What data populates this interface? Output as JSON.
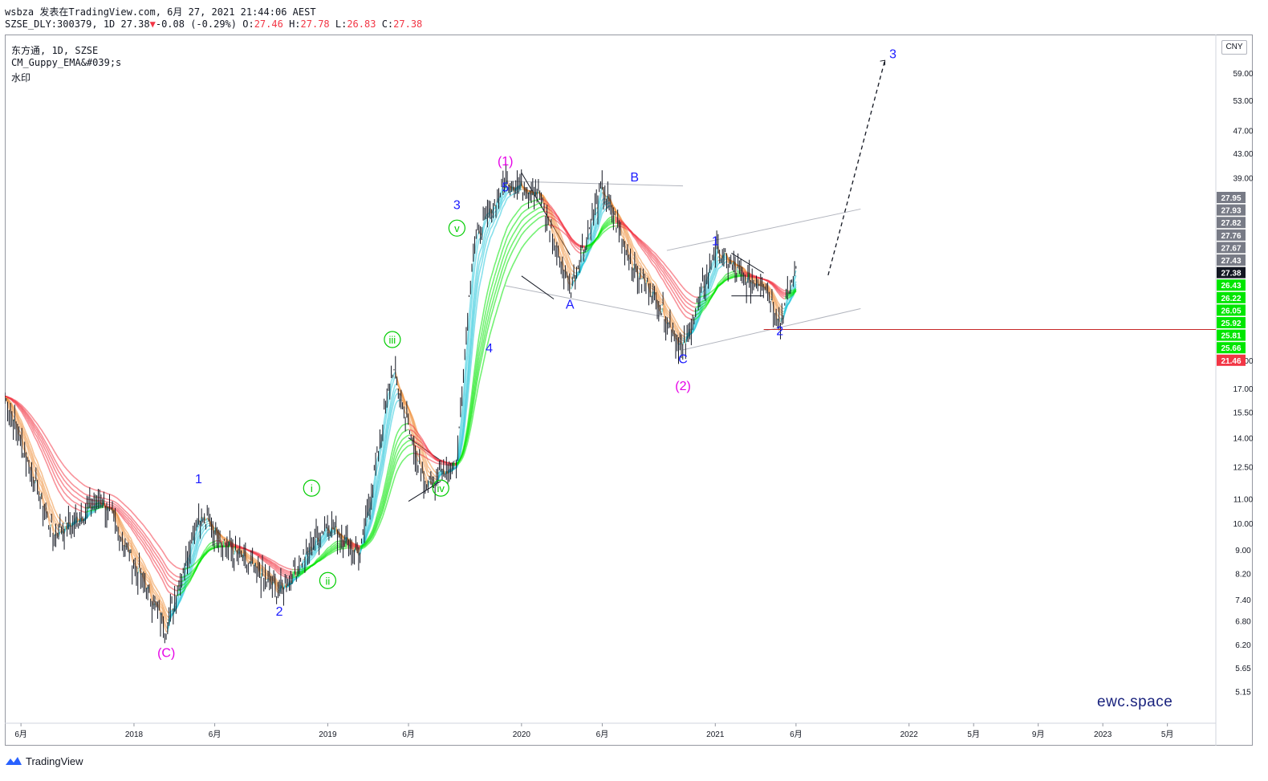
{
  "header": {
    "publisher": "wsbza 发表在TradingView.com, 6月 27, 2021 21:44:06 AEST",
    "symbol": "SZSE_DLY:300379, 1D 27.38",
    "change_arrow": "▼",
    "change": "-0.08 (-0.29%)",
    "o_label": "O:",
    "o_value": "27.46",
    "h_label": "H:",
    "h_value": "27.78",
    "l_label": "L:",
    "l_value": "26.83",
    "c_label": "C:",
    "c_value": "27.38"
  },
  "legend": {
    "line1": "东方通, 1D, SZSE",
    "line2": "CM_Guppy_EMA&#039;s",
    "line3": "水印"
  },
  "currency": "CNY",
  "watermark": "ewc.space",
  "footer": {
    "brand": "TradingView"
  },
  "colors": {
    "price_bars": "#131722",
    "ema_bull": "#00e600",
    "ema_bear": "#f23645",
    "ema_neutral": "#808080",
    "wave_blue": "#1a1aff",
    "wave_magenta": "#e600e6",
    "wave_green": "#00cc00",
    "support_line": "#c62828",
    "current_price": "#131722"
  },
  "chart_data": {
    "type": "line",
    "title": "",
    "xlabel": "",
    "ylabel": "",
    "y_scale": "log",
    "x_tick_labels": [
      "6月",
      "2018",
      "6月",
      "2019",
      "6月",
      "2020",
      "6月",
      "2021",
      "6月",
      "2022",
      "5月",
      "9月",
      "2023",
      "5月"
    ],
    "y_tick_labels": [
      "5.15",
      "5.65",
      "6.20",
      "6.80",
      "7.40",
      "8.20",
      "9.00",
      "10.00",
      "11.00",
      "12.50",
      "14.00",
      "15.50",
      "17.00",
      "19.00",
      "39.00",
      "43.00",
      "47.00",
      "53.00",
      "59.00"
    ],
    "y_ticks": [
      5.15,
      5.65,
      6.2,
      6.8,
      7.4,
      8.2,
      9.0,
      10.0,
      11.0,
      12.5,
      14.0,
      15.5,
      17.0,
      19.0,
      39.0,
      43.0,
      47.0,
      53.0,
      59.0
    ],
    "price_labels": [
      {
        "text": "27.95",
        "color": "#787b86"
      },
      {
        "text": "27.93",
        "color": "#787b86"
      },
      {
        "text": "27.82",
        "color": "#787b86"
      },
      {
        "text": "27.76",
        "color": "#787b86"
      },
      {
        "text": "27.67",
        "color": "#787b86"
      },
      {
        "text": "27.43",
        "color": "#787b86"
      },
      {
        "text": "27.38",
        "color": "#131722"
      },
      {
        "text": "26.43",
        "color": "#00e600"
      },
      {
        "text": "26.22",
        "color": "#00e600"
      },
      {
        "text": "26.05",
        "color": "#00e600"
      },
      {
        "text": "25.92",
        "color": "#00e600"
      },
      {
        "text": "25.81",
        "color": "#00e600"
      },
      {
        "text": "25.66",
        "color": "#00e600"
      },
      {
        "text": "21.46",
        "color": "#f23645"
      }
    ],
    "support_level": 21.46,
    "current_price": 27.38,
    "series": [
      {
        "name": "",
        "x": [
          "2017-05",
          "2017-08",
          "2017-11",
          "2018-01",
          "2018-03",
          "2018-05",
          "2018-07",
          "2018-10",
          "2019-01",
          "2019-03",
          "2019-05",
          "2019-07",
          "2019-08",
          "2019-09",
          "2019-10",
          "2019-12",
          "2020-02",
          "2020-04",
          "2020-06",
          "2020-08",
          "2020-09",
          "2020-11",
          "2021-01",
          "2021-03",
          "2021-04",
          "2021-05",
          "2021-06"
        ],
        "y": [
          16.5,
          9.5,
          11.0,
          8.5,
          6.6,
          10.4,
          9.0,
          7.6,
          10.0,
          8.8,
          18.5,
          11.5,
          12.2,
          12.8,
          30.0,
          38.5,
          37.0,
          25.0,
          37.5,
          27.0,
          25.0,
          19.8,
          29.5,
          25.8,
          26.0,
          22.0,
          27.4
        ]
      },
      {
        "name": "",
        "x": [
          "2021-06",
          "2021-12"
        ],
        "y": [
          27.4,
          62.0
        ]
      }
    ],
    "wave_labels": [
      {
        "text": "(C)",
        "x": "2018-03",
        "y": 5.9,
        "color": "#e600e6"
      },
      {
        "text": "1",
        "x": "2018-05",
        "y": 11.7,
        "color": "#1a1aff"
      },
      {
        "text": "2",
        "x": "2018-10",
        "y": 6.95,
        "color": "#1a1aff"
      },
      {
        "text": "i",
        "x": "2018-12",
        "y": 11.3,
        "color": "#00cc00"
      },
      {
        "text": "ii",
        "x": "2019-01",
        "y": 7.85,
        "color": "#00cc00"
      },
      {
        "text": "iii",
        "x": "2019-05",
        "y": 20.3,
        "color": "#00cc00"
      },
      {
        "text": "iv",
        "x": "2019-08",
        "y": 11.3,
        "color": "#00cc00"
      },
      {
        "text": "v",
        "x": "2019-09",
        "y": 31.5,
        "color": "#00cc00"
      },
      {
        "text": "3",
        "x": "2019-09",
        "y": 34.5,
        "color": "#1a1aff"
      },
      {
        "text": "4",
        "x": "2019-11",
        "y": 19.6,
        "color": "#1a1aff"
      },
      {
        "text": "5",
        "x": "2019-12",
        "y": 37.0,
        "color": "#1a1aff"
      },
      {
        "text": "(1)",
        "x": "2019-12",
        "y": 41.0,
        "color": "#e600e6"
      },
      {
        "text": "A",
        "x": "2020-04",
        "y": 23.3,
        "color": "#1a1aff"
      },
      {
        "text": "B",
        "x": "2020-08",
        "y": 38.5,
        "color": "#1a1aff"
      },
      {
        "text": "C",
        "x": "2020-11",
        "y": 18.8,
        "color": "#1a1aff"
      },
      {
        "text": "(2)",
        "x": "2020-11",
        "y": 16.9,
        "color": "#e600e6"
      },
      {
        "text": "1",
        "x": "2021-01",
        "y": 29.9,
        "color": "#1a1aff"
      },
      {
        "text": "2",
        "x": "2021-05",
        "y": 21.0,
        "color": "#1a1aff"
      },
      {
        "text": "3",
        "x": "2021-12",
        "y": 62.5,
        "color": "#1a1aff"
      }
    ],
    "grid": false,
    "legend_position": "top-left"
  }
}
